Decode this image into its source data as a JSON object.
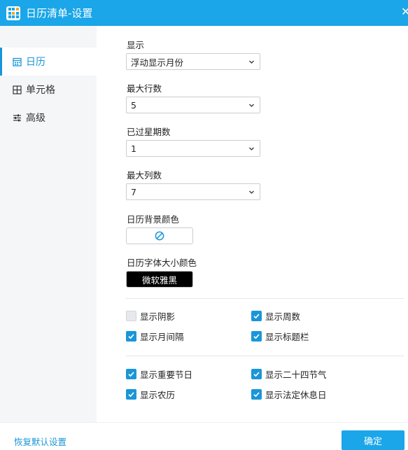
{
  "window": {
    "title": "日历清单-设置"
  },
  "sidebar": {
    "items": [
      {
        "label": "日历",
        "icon": "calendar-icon",
        "active": true
      },
      {
        "label": "单元格",
        "icon": "grid-icon",
        "active": false
      },
      {
        "label": "高级",
        "icon": "sliders-icon",
        "active": false
      }
    ]
  },
  "settings": {
    "display": {
      "label": "显示",
      "value": "浮动显示月份"
    },
    "max_rows": {
      "label": "最大行数",
      "value": "5"
    },
    "past_weeks": {
      "label": "已过星期数",
      "value": "1"
    },
    "max_cols": {
      "label": "最大列数",
      "value": "7"
    },
    "bg_color": {
      "label": "日历背景颜色",
      "icon": "no-color-icon"
    },
    "font": {
      "label": "日历字体大小颜色",
      "value": "微软雅黑"
    }
  },
  "checkboxes": {
    "shadow": {
      "label": "显示阴影",
      "checked": false
    },
    "week_num": {
      "label": "显示周数",
      "checked": true
    },
    "month_gap": {
      "label": "显示月间隔",
      "checked": true
    },
    "title_bar": {
      "label": "显示标题栏",
      "checked": true
    },
    "festivals": {
      "label": "显示重要节日",
      "checked": true
    },
    "solar_terms": {
      "label": "显示二十四节气",
      "checked": true
    },
    "lunar": {
      "label": "显示农历",
      "checked": true
    },
    "holidays": {
      "label": "显示法定休息日",
      "checked": true
    }
  },
  "footer": {
    "restore_label": "恢复默认设置",
    "ok_label": "确定"
  },
  "colors": {
    "accent": "#1aa6e8",
    "link": "#1a96d8",
    "sidebar_bg": "#f4f6f8"
  }
}
